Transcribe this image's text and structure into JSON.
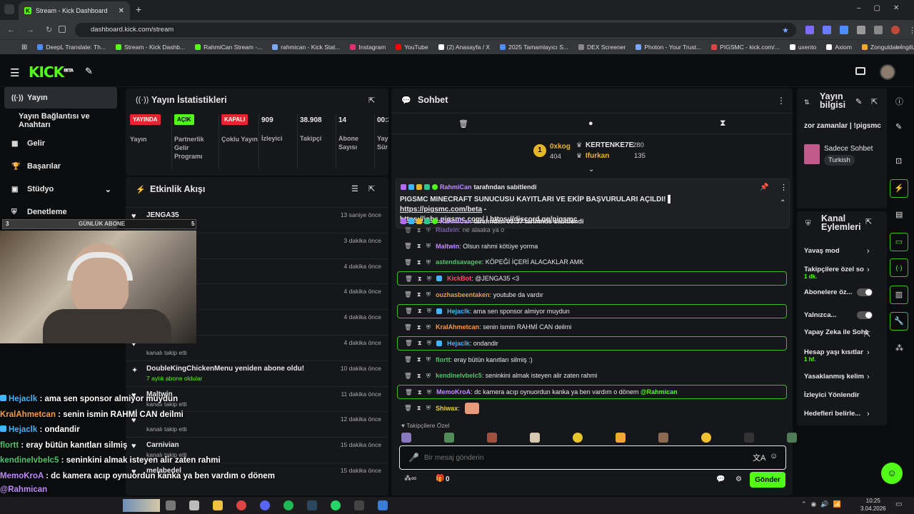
{
  "browser": {
    "tab_title": "Stream - Kick Dashboard",
    "url": "dashboard.kick.com/stream",
    "bookmarks": [
      "DeepL Translate: Th...",
      "Stream - Kick Dashb...",
      "RahmiCan Stream -...",
      "rahmican - Kick Stat...",
      "Instagram",
      "YouTube",
      "(2) Anasayfa / X",
      "2025 Tamamlayıcı S...",
      "DEX Screener",
      "Photon - Your Trust...",
      "PIGSMC - kick.com/...",
      "uxento",
      "Axiom",
      "Zonguldak İngilizce..."
    ]
  },
  "app": {
    "logo": "KICK",
    "beta": "BETA"
  },
  "sidebar": {
    "items": [
      {
        "label": "Yayın"
      },
      {
        "label": "Yayın Bağlantısı ve Anahtarı"
      },
      {
        "label": "Gelir"
      },
      {
        "label": "Başarılar"
      },
      {
        "label": "Stüdyo"
      },
      {
        "label": "Denetleme"
      }
    ]
  },
  "stats": {
    "title": "Yayın İstatistikleri",
    "items": [
      {
        "badge": "YAYINDA",
        "label": "Yayın"
      },
      {
        "badge": "AÇIK",
        "label": "Partnerlik Gelir Programı"
      },
      {
        "badge": "KAPALI",
        "label": "Çoklu Yayın"
      },
      {
        "value": "909",
        "label": "İzleyici"
      },
      {
        "value": "38.908",
        "label": "Takipçi"
      },
      {
        "value": "14",
        "label": "Abone Sayısı"
      },
      {
        "value": "00:3",
        "label": "Yay Old Sür"
      }
    ]
  },
  "activity": {
    "title": "Etkinlik Akışı",
    "rows": [
      {
        "name": "JENGA35",
        "sub": "kanalı takip etti",
        "time": "13 saniye önce"
      },
      {
        "name": "",
        "sub": "",
        "time": "3 dakika önce"
      },
      {
        "name": "",
        "sub": "",
        "time": "4 dakika önce"
      },
      {
        "name": "",
        "sub": "",
        "time": "4 dakika önce"
      },
      {
        "name": "",
        "sub": "",
        "time": "4 dakika önce"
      },
      {
        "name": "",
        "sub": "kanalı takip etti",
        "time": "4 dakika önce"
      },
      {
        "name": "DoubleKingChickenMenu yeniden abone oldu!",
        "sub": "7 aylık abone oldular",
        "time": "10 dakika önce"
      },
      {
        "name": "Maltwin",
        "sub": "kanalı takip etti",
        "time": "11 dakika önce"
      },
      {
        "name": "",
        "sub": "kanalı takip etti",
        "time": "12 dakika önce"
      },
      {
        "name": "Carnivian",
        "sub": "kanalı takip etti",
        "time": "15 dakika önce"
      },
      {
        "name": "melabedel",
        "sub": "",
        "time": "15 dakika önce"
      }
    ]
  },
  "goal": {
    "left": "3",
    "label": "GÜNLÜK ABONE",
    "right": "5"
  },
  "chat": {
    "title": "Sohbet",
    "leaders": [
      {
        "name": "0xkog",
        "value": "404"
      },
      {
        "name": "KERTENKE7E",
        "value": "280"
      },
      {
        "name": "Ifurkan",
        "value": "135"
      }
    ],
    "pinned": {
      "by_top": "RahmiCan",
      "by_top_suffix": "tarafından sabitlendi",
      "message": "PIGSMC MINECRAFT SUNUCUSU KAYITLARI VE EKİP BAŞVURULARI AÇILDI! ",
      "link1": "https://pigsmc.com/beta",
      "sep1": " - ",
      "link2": "https://jobs.pigsmc.com/",
      "sep2": " | ",
      "link3": "https://discord.gg/pigsmc",
      "by_bottom": "RahmiCan",
      "by_bottom_suffix": "tarafından 09:37 tarihinde sabitlendi"
    },
    "messages": [
      {
        "user": "Riadein",
        "text": "ne alaaka ya o",
        "color": "#b78bff",
        "hl": false
      },
      {
        "user": "Maltwin",
        "text": "Olsun rahmi kötüye yorma",
        "color": "#c08cff",
        "hl": false
      },
      {
        "user": "astendsavagee",
        "text": "KÖPEĞİ İÇERİ ALACAKLAR AMK",
        "color": "#53c26b",
        "hl": false
      },
      {
        "user": "KickBot",
        "text": "@JENGA35 <3",
        "color": "#ff4f6b",
        "hl": true
      },
      {
        "user": "ouzhasbeentaken",
        "text": "youtube da vardır",
        "color": "#e7a03b",
        "hl": false
      },
      {
        "user": "Hejaclk",
        "text": "ama sen sponsor almiyor muydun",
        "color": "#41b5ff",
        "hl": true
      },
      {
        "user": "KralAhmetcan",
        "text": "senin ismin RAHMİ CAN deilmi",
        "color": "#f29c4a",
        "hl": false
      },
      {
        "user": "Hejaclk",
        "text": "ondandir",
        "color": "#41b5ff",
        "hl": true
      },
      {
        "user": "flortt",
        "text": "eray bütün kanıtları silmiş :)",
        "color": "#53c26b",
        "hl": false
      },
      {
        "user": "kendinelvbelc5",
        "text": "seninkini almak isteyen alir zaten rahmi",
        "color": "#53c26b",
        "hl": false
      },
      {
        "user": "MemoKroA",
        "text": "dc kamera acıp oynuordun kanka ya ben vardım o dönem ",
        "mention": "@Rahmican",
        "color": "#c08cff",
        "hl": true
      },
      {
        "user": "Shiwax",
        "text": "",
        "color": "#e7d23b",
        "hl": false
      }
    ],
    "emote_label": "Takipçilere Özel",
    "placeholder": "Bir mesaj gönderin",
    "count": "0",
    "send": "Gönder"
  },
  "info": {
    "title": "Yayın bilgisi",
    "stream_title": "zor zamanlar | !pigsmc",
    "category": "Sadece Sohbet",
    "tag": "Turkish"
  },
  "actions": {
    "title": "Kanal Eylemleri",
    "items": [
      {
        "label": "Yavaş mod",
        "sub": ""
      },
      {
        "label": "Takipçilere özel so",
        "sub": "1 dk."
      },
      {
        "label": "Abonelere öz...",
        "sub": ""
      },
      {
        "label": "Yalnızca...",
        "sub": ""
      },
      {
        "label": "Yapay Zeka ile Sohbet Denetimi",
        "sub": ""
      },
      {
        "label": "Hesap yaşı kısıtlar",
        "sub": "1 hf."
      },
      {
        "label": "Yasaklanmış kelim",
        "sub": ""
      },
      {
        "label": "İzleyici Yönlendir",
        "sub": ""
      },
      {
        "label": "Hedefleri belirle...",
        "sub": ""
      }
    ]
  },
  "overlay": {
    "lines": [
      {
        "user": "Hejaclk",
        "text": " : ama sen sponsor almiyor muydun",
        "color": "#41b5ff"
      },
      {
        "user": "KralAhmetcan",
        "text": " : senin ismin RAHMİ CAN deilmi",
        "color": "#f29c4a"
      },
      {
        "user": "Hejaclk",
        "text": " : ondandir",
        "color": "#41b5ff"
      },
      {
        "user": "flortt",
        "text": " : eray bütün kanıtları silmiş",
        "color": "#53c26b"
      },
      {
        "user": "kendinelvbelc5",
        "text": " : seninkini almak isteyen alir zaten rahmi",
        "color": "#53c26b"
      },
      {
        "user": "MemoKroA",
        "text": " : dc kamera acıp oynuordun kanka ya ben vardım o dönem",
        "color": "#c08cff"
      },
      {
        "user": "@Rahmican",
        "text": "",
        "color": "#c08cff"
      },
      {
        "user": "Shiwax",
        "text": " :",
        "color": "#e7d23b"
      }
    ]
  },
  "clock": {
    "time": "10:25",
    "date": "3.04.2026"
  },
  "colors": {
    "accent": "#53fc18",
    "live": "#e3262f",
    "panel": "#16171a"
  }
}
